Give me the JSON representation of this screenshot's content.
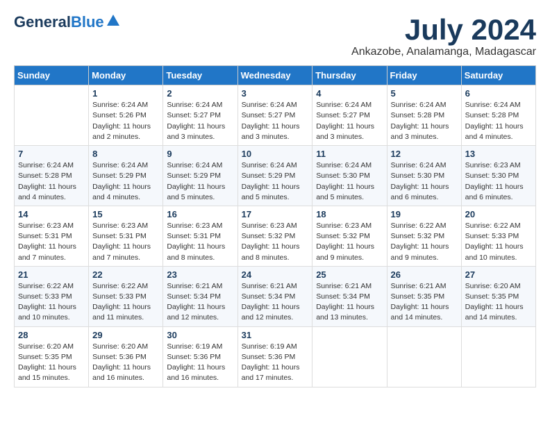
{
  "logo": {
    "line1": "General",
    "line2": "Blue"
  },
  "title": {
    "month_year": "July 2024",
    "location": "Ankazobe, Analamanga, Madagascar"
  },
  "days_of_week": [
    "Sunday",
    "Monday",
    "Tuesday",
    "Wednesday",
    "Thursday",
    "Friday",
    "Saturday"
  ],
  "weeks": [
    [
      {
        "day": "",
        "sunrise": "",
        "sunset": "",
        "daylight": ""
      },
      {
        "day": "1",
        "sunrise": "Sunrise: 6:24 AM",
        "sunset": "Sunset: 5:26 PM",
        "daylight": "Daylight: 11 hours and 2 minutes."
      },
      {
        "day": "2",
        "sunrise": "Sunrise: 6:24 AM",
        "sunset": "Sunset: 5:27 PM",
        "daylight": "Daylight: 11 hours and 3 minutes."
      },
      {
        "day": "3",
        "sunrise": "Sunrise: 6:24 AM",
        "sunset": "Sunset: 5:27 PM",
        "daylight": "Daylight: 11 hours and 3 minutes."
      },
      {
        "day": "4",
        "sunrise": "Sunrise: 6:24 AM",
        "sunset": "Sunset: 5:27 PM",
        "daylight": "Daylight: 11 hours and 3 minutes."
      },
      {
        "day": "5",
        "sunrise": "Sunrise: 6:24 AM",
        "sunset": "Sunset: 5:28 PM",
        "daylight": "Daylight: 11 hours and 3 minutes."
      },
      {
        "day": "6",
        "sunrise": "Sunrise: 6:24 AM",
        "sunset": "Sunset: 5:28 PM",
        "daylight": "Daylight: 11 hours and 4 minutes."
      }
    ],
    [
      {
        "day": "7",
        "sunrise": "Sunrise: 6:24 AM",
        "sunset": "Sunset: 5:28 PM",
        "daylight": "Daylight: 11 hours and 4 minutes."
      },
      {
        "day": "8",
        "sunrise": "Sunrise: 6:24 AM",
        "sunset": "Sunset: 5:29 PM",
        "daylight": "Daylight: 11 hours and 4 minutes."
      },
      {
        "day": "9",
        "sunrise": "Sunrise: 6:24 AM",
        "sunset": "Sunset: 5:29 PM",
        "daylight": "Daylight: 11 hours and 5 minutes."
      },
      {
        "day": "10",
        "sunrise": "Sunrise: 6:24 AM",
        "sunset": "Sunset: 5:29 PM",
        "daylight": "Daylight: 11 hours and 5 minutes."
      },
      {
        "day": "11",
        "sunrise": "Sunrise: 6:24 AM",
        "sunset": "Sunset: 5:30 PM",
        "daylight": "Daylight: 11 hours and 5 minutes."
      },
      {
        "day": "12",
        "sunrise": "Sunrise: 6:24 AM",
        "sunset": "Sunset: 5:30 PM",
        "daylight": "Daylight: 11 hours and 6 minutes."
      },
      {
        "day": "13",
        "sunrise": "Sunrise: 6:23 AM",
        "sunset": "Sunset: 5:30 PM",
        "daylight": "Daylight: 11 hours and 6 minutes."
      }
    ],
    [
      {
        "day": "14",
        "sunrise": "Sunrise: 6:23 AM",
        "sunset": "Sunset: 5:31 PM",
        "daylight": "Daylight: 11 hours and 7 minutes."
      },
      {
        "day": "15",
        "sunrise": "Sunrise: 6:23 AM",
        "sunset": "Sunset: 5:31 PM",
        "daylight": "Daylight: 11 hours and 7 minutes."
      },
      {
        "day": "16",
        "sunrise": "Sunrise: 6:23 AM",
        "sunset": "Sunset: 5:31 PM",
        "daylight": "Daylight: 11 hours and 8 minutes."
      },
      {
        "day": "17",
        "sunrise": "Sunrise: 6:23 AM",
        "sunset": "Sunset: 5:32 PM",
        "daylight": "Daylight: 11 hours and 8 minutes."
      },
      {
        "day": "18",
        "sunrise": "Sunrise: 6:23 AM",
        "sunset": "Sunset: 5:32 PM",
        "daylight": "Daylight: 11 hours and 9 minutes."
      },
      {
        "day": "19",
        "sunrise": "Sunrise: 6:22 AM",
        "sunset": "Sunset: 5:32 PM",
        "daylight": "Daylight: 11 hours and 9 minutes."
      },
      {
        "day": "20",
        "sunrise": "Sunrise: 6:22 AM",
        "sunset": "Sunset: 5:33 PM",
        "daylight": "Daylight: 11 hours and 10 minutes."
      }
    ],
    [
      {
        "day": "21",
        "sunrise": "Sunrise: 6:22 AM",
        "sunset": "Sunset: 5:33 PM",
        "daylight": "Daylight: 11 hours and 10 minutes."
      },
      {
        "day": "22",
        "sunrise": "Sunrise: 6:22 AM",
        "sunset": "Sunset: 5:33 PM",
        "daylight": "Daylight: 11 hours and 11 minutes."
      },
      {
        "day": "23",
        "sunrise": "Sunrise: 6:21 AM",
        "sunset": "Sunset: 5:34 PM",
        "daylight": "Daylight: 11 hours and 12 minutes."
      },
      {
        "day": "24",
        "sunrise": "Sunrise: 6:21 AM",
        "sunset": "Sunset: 5:34 PM",
        "daylight": "Daylight: 11 hours and 12 minutes."
      },
      {
        "day": "25",
        "sunrise": "Sunrise: 6:21 AM",
        "sunset": "Sunset: 5:34 PM",
        "daylight": "Daylight: 11 hours and 13 minutes."
      },
      {
        "day": "26",
        "sunrise": "Sunrise: 6:21 AM",
        "sunset": "Sunset: 5:35 PM",
        "daylight": "Daylight: 11 hours and 14 minutes."
      },
      {
        "day": "27",
        "sunrise": "Sunrise: 6:20 AM",
        "sunset": "Sunset: 5:35 PM",
        "daylight": "Daylight: 11 hours and 14 minutes."
      }
    ],
    [
      {
        "day": "28",
        "sunrise": "Sunrise: 6:20 AM",
        "sunset": "Sunset: 5:35 PM",
        "daylight": "Daylight: 11 hours and 15 minutes."
      },
      {
        "day": "29",
        "sunrise": "Sunrise: 6:20 AM",
        "sunset": "Sunset: 5:36 PM",
        "daylight": "Daylight: 11 hours and 16 minutes."
      },
      {
        "day": "30",
        "sunrise": "Sunrise: 6:19 AM",
        "sunset": "Sunset: 5:36 PM",
        "daylight": "Daylight: 11 hours and 16 minutes."
      },
      {
        "day": "31",
        "sunrise": "Sunrise: 6:19 AM",
        "sunset": "Sunset: 5:36 PM",
        "daylight": "Daylight: 11 hours and 17 minutes."
      },
      {
        "day": "",
        "sunrise": "",
        "sunset": "",
        "daylight": ""
      },
      {
        "day": "",
        "sunrise": "",
        "sunset": "",
        "daylight": ""
      },
      {
        "day": "",
        "sunrise": "",
        "sunset": "",
        "daylight": ""
      }
    ]
  ]
}
